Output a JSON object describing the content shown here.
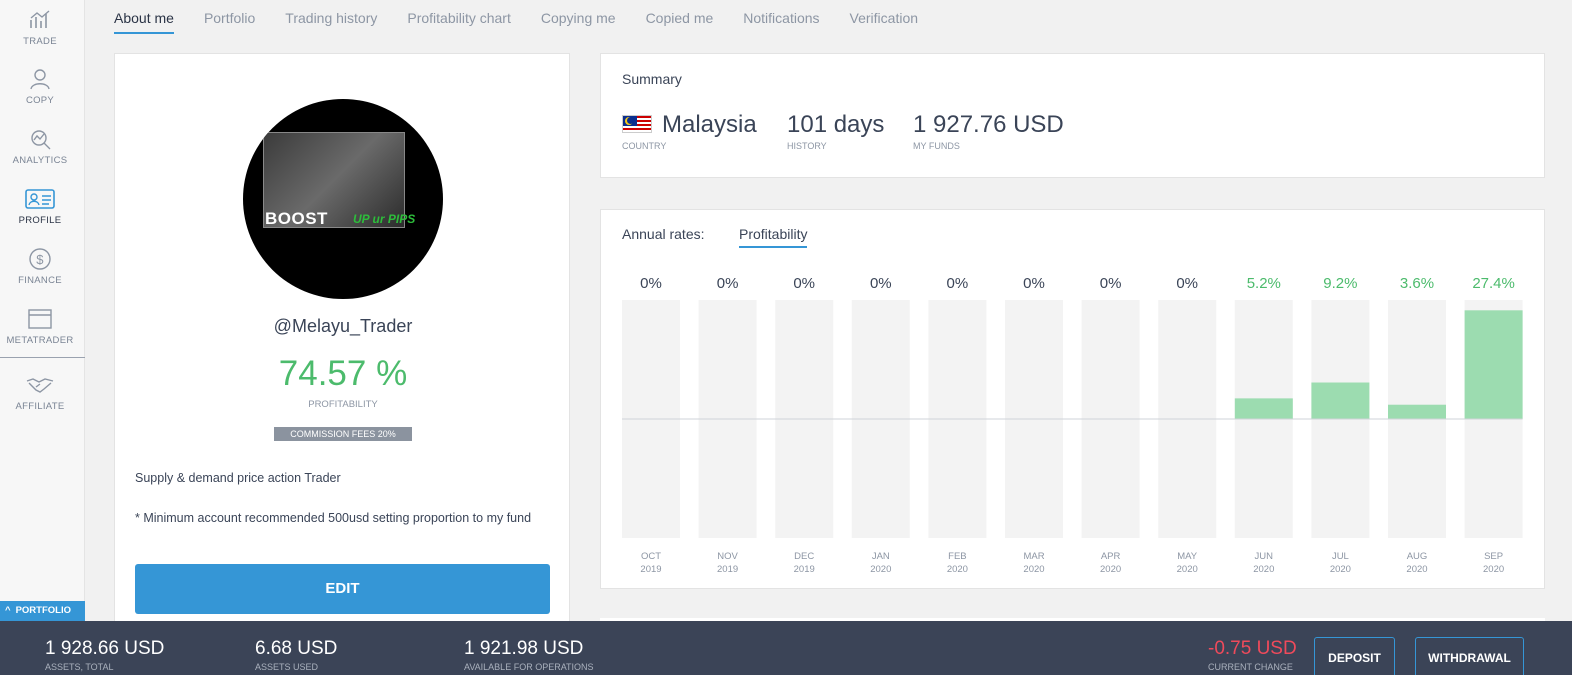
{
  "sidebar": {
    "items": [
      {
        "label": "TRADE",
        "icon": "trade-chart-icon"
      },
      {
        "label": "COPY",
        "icon": "copy-person-icon"
      },
      {
        "label": "ANALYTICS",
        "icon": "analytics-icon"
      },
      {
        "label": "PROFILE",
        "icon": "profile-card-icon",
        "active": true
      },
      {
        "label": "FINANCE",
        "icon": "dollar-icon"
      },
      {
        "label": "METATRADER",
        "icon": "window-icon"
      },
      {
        "label": "AFFILIATE",
        "icon": "handshake-icon"
      }
    ],
    "portfolio_label": "PORTFOLIO"
  },
  "tabs": [
    {
      "label": "About me",
      "active": true
    },
    {
      "label": "Portfolio"
    },
    {
      "label": "Trading history"
    },
    {
      "label": "Profitability chart"
    },
    {
      "label": "Copying me"
    },
    {
      "label": "Copied me"
    },
    {
      "label": "Notifications"
    },
    {
      "label": "Verification"
    }
  ],
  "profile": {
    "avatar_text": "BOOST",
    "avatar_tagline": "UP ur PIPS",
    "username": "@Melayu_Trader",
    "profitability": "74.57 %",
    "profitability_label": "PROFITABILITY",
    "commission": "COMMISSION FEES 20%",
    "bio_line1": "Supply & demand price action Trader",
    "bio_line2": "* Minimum account recommended 500usd setting proportion to my fund",
    "edit_label": "EDIT"
  },
  "summary": {
    "title": "Summary",
    "country": "Malaysia",
    "country_label": "COUNTRY",
    "history": "101 days",
    "history_label": "HISTORY",
    "funds": "1 927.76 USD",
    "funds_label": "MY FUNDS"
  },
  "annual": {
    "label": "Annual rates:",
    "tab": "Profitability"
  },
  "chart_data": {
    "type": "bar",
    "categories": [
      "OCT 2019",
      "NOV 2019",
      "DEC 2019",
      "JAN 2020",
      "FEB 2020",
      "MAR 2020",
      "APR 2020",
      "MAY 2020",
      "JUN 2020",
      "JUL 2020",
      "AUG 2020",
      "SEP 2020"
    ],
    "months": [
      "OCT",
      "NOV",
      "DEC",
      "JAN",
      "FEB",
      "MAR",
      "APR",
      "MAY",
      "JUN",
      "JUL",
      "AUG",
      "SEP"
    ],
    "years": [
      "2019",
      "2019",
      "2019",
      "2020",
      "2020",
      "2020",
      "2020",
      "2020",
      "2020",
      "2020",
      "2020",
      "2020"
    ],
    "values": [
      0,
      0,
      0,
      0,
      0,
      0,
      0,
      0,
      5.2,
      9.2,
      3.6,
      27.4
    ],
    "value_labels": [
      "0%",
      "0%",
      "0%",
      "0%",
      "0%",
      "0%",
      "0%",
      "0%",
      "5.2%",
      "9.2%",
      "3.6%",
      "27.4%"
    ],
    "ylim": [
      -30,
      30
    ],
    "colors": {
      "positive": "#9cdcb0",
      "track": "#f3f3f3",
      "positive_label": "#4cbb6c",
      "zero_label": "#3a4457"
    }
  },
  "footer": {
    "assets_total": "1 928.66 USD",
    "assets_total_label": "ASSETS, TOTAL",
    "assets_used": "6.68 USD",
    "assets_used_label": "ASSETS USED",
    "available": "1 921.98 USD",
    "available_label": "AVAILABLE FOR OPERATIONS",
    "current_change": "-0.75 USD",
    "current_change_label": "CURRENT CHANGE",
    "deposit_label": "DEPOSIT",
    "withdrawal_label": "WITHDRAWAL"
  },
  "colors": {
    "accent": "#3596d6",
    "positive": "#4cbb6c",
    "negative": "#ef4a5b",
    "footer_bg": "#3b4457"
  }
}
